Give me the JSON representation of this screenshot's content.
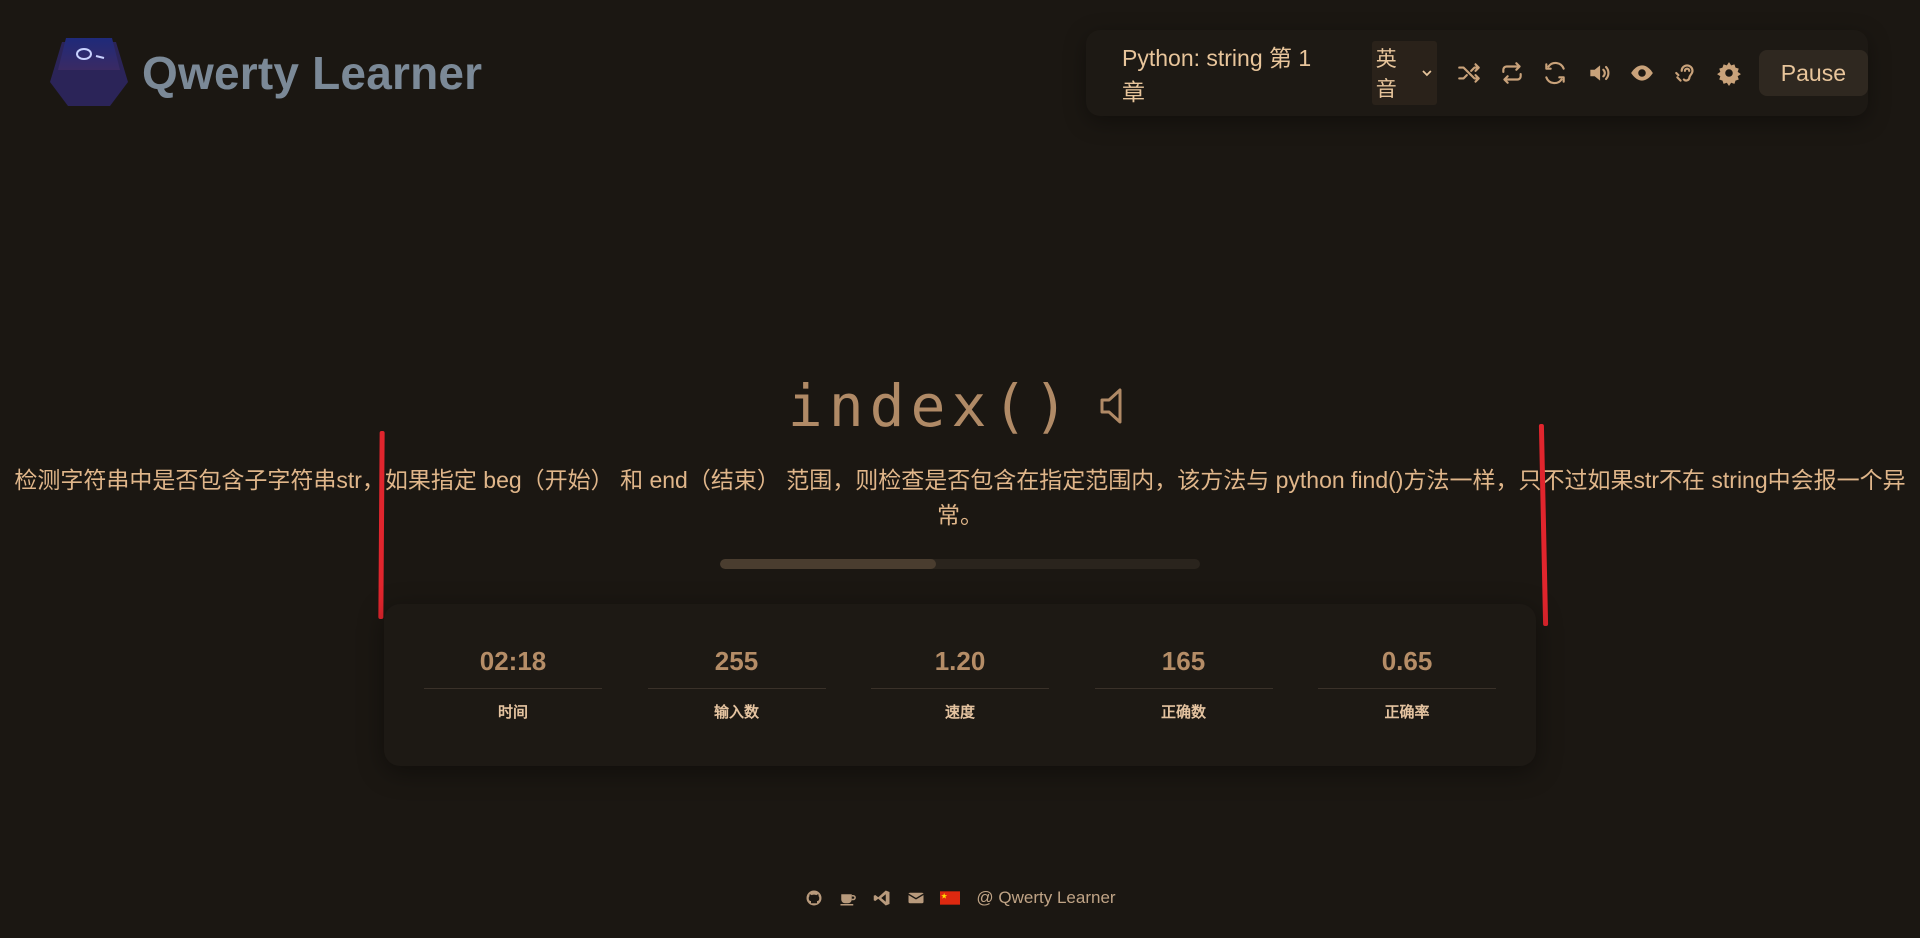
{
  "header": {
    "app_title": "Qwerty Learner",
    "logo_icon": "keycap-logo-icon"
  },
  "toolbar": {
    "chapter_label": "Python: string 第 1 章",
    "accent_select": "英音",
    "icons": [
      "shuffle-icon",
      "repeat-icon",
      "refresh-icon",
      "volume-icon",
      "eye-icon",
      "hearing-icon",
      "gear-icon"
    ],
    "pause_label": "Pause"
  },
  "word": {
    "text": "index()",
    "sound_icon": "speaker-icon",
    "translation": "检测字符串中是否包含子字符串str，如果指定 beg（开始） 和 end（结束） 范围，则检查是否包含在指定范围内，该方法与 python find()方法一样，只不过如果str不在 string中会报一个异常。"
  },
  "progress": {
    "fraction": 0.45
  },
  "stats": [
    {
      "value": "02:18",
      "label": "时间"
    },
    {
      "value": "255",
      "label": "输入数"
    },
    {
      "value": "1.20",
      "label": "速度"
    },
    {
      "value": "165",
      "label": "正确数"
    },
    {
      "value": "0.65",
      "label": "正确率"
    }
  ],
  "footer": {
    "icons": [
      "github-icon",
      "coffee-icon",
      "vscode-icon",
      "mail-icon",
      "china-flag-icon"
    ],
    "text": "@ Qwerty Learner"
  },
  "colors": {
    "background": "#1b1712",
    "accent": "#e8c59b",
    "annotation_red": "#e0252d"
  }
}
